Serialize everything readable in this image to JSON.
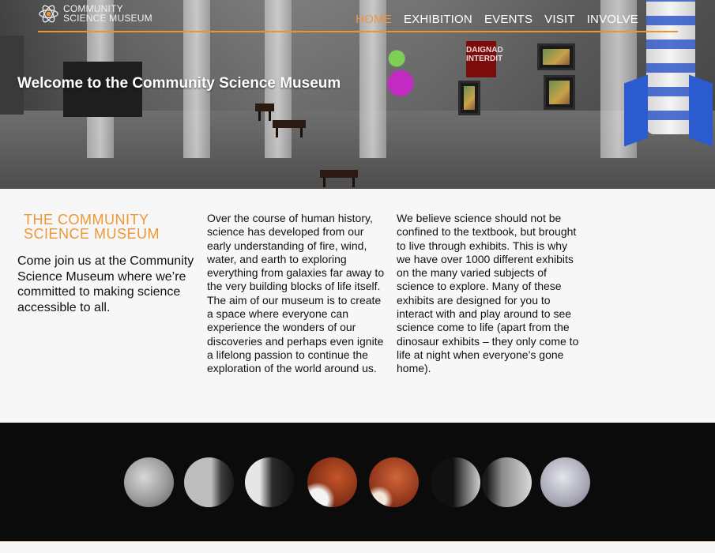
{
  "header": {
    "logo_line1": "COMMUNITY",
    "logo_line2": "SCIENCE MUSEUM",
    "nav": [
      {
        "label": "HOME",
        "active": true
      },
      {
        "label": "EXHIBITION",
        "active": false
      },
      {
        "label": "EVENTS",
        "active": false
      },
      {
        "label": "VISIT",
        "active": false
      },
      {
        "label": "INVOLVE",
        "active": false
      }
    ],
    "accent_color": "#f0943a"
  },
  "hero": {
    "title": "Welcome to the Community Science Museum",
    "sign_text": "DAIGNAD INTERDIT"
  },
  "main": {
    "brand_line1": "THE COMMUNITY",
    "brand_line2": "SCIENCE MUSEUM",
    "intro": "Come join us at the Community Science Museum where we’re committed to making science accessible to all.",
    "column1": "Over the course of human history, science has developed from our early understanding of fire, wind, water, and earth to exploring everything from galaxies far away to the very building blocks of life itself. The aim of our museum is to create a space where everyone can experience the wonders of our discoveries and perhaps even ignite a lifelong passion to continue the exploration of the world around us.",
    "column2": "We believe science should not be confined to the textbook, but brought to live through exhibits. This is why we have over 1000 different exhibits on the many varied subjects of science to explore. Many of these exhibits are designed for you to interact with and play around to see science come to life (apart from the dinosaur exhibits – they only come to life at night when everyone’s gone home)."
  },
  "gallery": {
    "image_name": "lunar-eclipse-phases-image",
    "moon_count": 8
  }
}
